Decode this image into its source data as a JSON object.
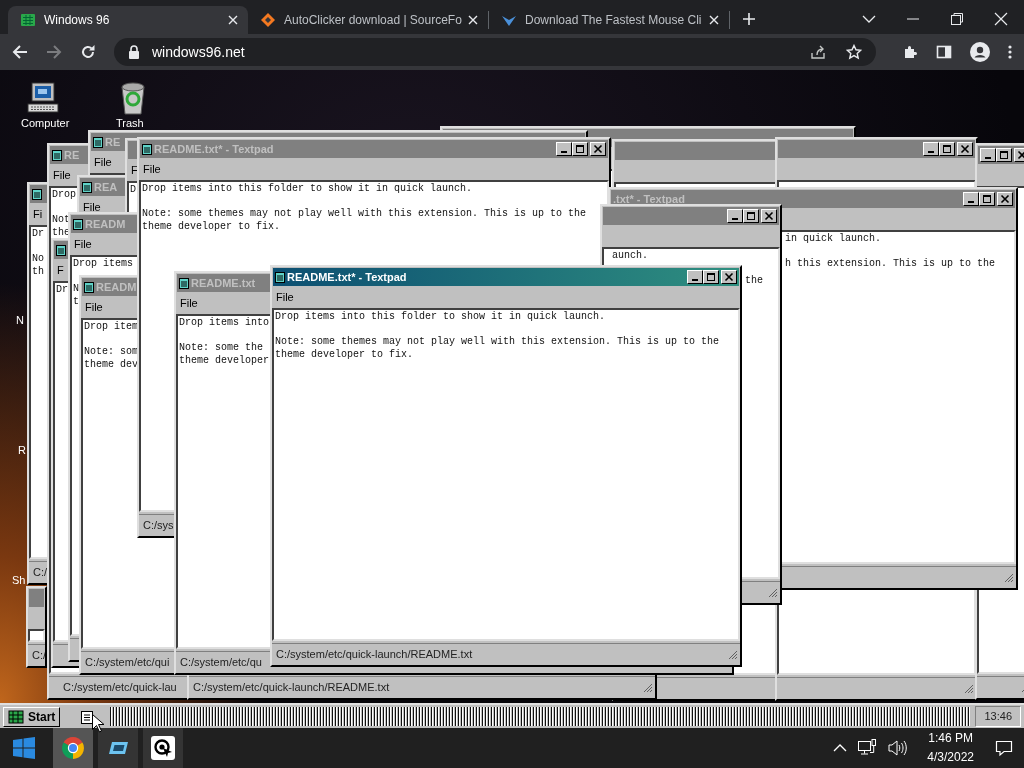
{
  "browser": {
    "tabs": [
      {
        "title": "Windows 96",
        "selected": true
      },
      {
        "title": "AutoClicker download | SourceFo",
        "selected": false
      },
      {
        "title": "Download The Fastest Mouse Cli",
        "selected": false
      }
    ],
    "address": "windows96.net"
  },
  "desktop": {
    "icons": [
      {
        "label": "Computer",
        "kind": "computer"
      },
      {
        "label": "Trash",
        "kind": "trash"
      }
    ],
    "cut_labels": [
      "N",
      "R",
      "Sh"
    ]
  },
  "windows": [
    {
      "active": false
    },
    {
      "active": false
    },
    {
      "active": false
    },
    {
      "active": false
    },
    {
      "active": false,
      "menu": "Fi",
      "paragraphs": [
        [
          "Dr"
        ],
        [
          "No",
          "th"
        ]
      ],
      "status": "C:/"
    },
    {
      "active": false,
      "status": "C:/"
    },
    {
      "active": false,
      "title": "RE",
      "menu": "File",
      "paragraphs": [
        [
          "Drop"
        ],
        [
          "Not",
          "the"
        ]
      ],
      "status": "C:/system/etc/quick-lau"
    },
    {
      "active": false,
      "title": "RE",
      "menu": "File"
    },
    {
      "active": false,
      "title": "REA",
      "menu": "File"
    },
    {
      "active": false,
      "menu": "F",
      "paragraphs": [
        [
          "D"
        ]
      ]
    },
    {
      "active": false,
      "menu": "F",
      "paragraphs": [
        [
          "Dr"
        ]
      ]
    },
    {
      "active": false,
      "title": "READM",
      "menu": "File",
      "paragraphs": [
        [
          "Drop items"
        ],
        [
          "N",
          "t"
        ]
      ]
    },
    {
      "status": "C:/system/etc/quick-launch/README.txt"
    },
    {
      "active": false,
      "title": "README.txt* - Textpad",
      "menu": "File",
      "paragraphs": [
        [
          "Drop items into this folder to show it in quick launch."
        ],
        [
          "Note: some themes may not play well with this extension. This is up to the",
          "theme developer to fix."
        ]
      ],
      "status": "C:/sys"
    },
    {
      "active": false,
      "title": "READM",
      "menu": "File",
      "paragraphs": [
        [
          "Drop item"
        ],
        [
          "Note: som",
          "theme dev"
        ]
      ],
      "status": "C:/system/etc/qui"
    },
    {
      "active": false,
      "title": ".txt* - Textpad",
      "paragraphs": [
        [
          "in quick launch."
        ],
        [
          "h this extension. This is up to the"
        ]
      ]
    },
    {
      "active": false,
      "paragraphs": [
        [
          "aunch."
        ],
        [
          "the"
        ]
      ]
    },
    {
      "active": false,
      "title": "README.txt",
      "menu": "File",
      "paragraphs": [
        [
          "Drop items into"
        ],
        [
          "Note: some the",
          "theme developer"
        ]
      ],
      "status": "C:/system/etc/qu"
    },
    {
      "active": true,
      "title": "README.txt* - Textpad",
      "menu": "File",
      "paragraphs": [
        [
          "Drop items into this folder to show it in quick launch."
        ],
        [
          "Note: some themes may not play well with this extension. This is up to the",
          "theme developer to fix."
        ]
      ],
      "status": "C:/system/etc/quick-launch/README.txt"
    }
  ],
  "taskbar96": {
    "start": "Start",
    "clock": "13:46"
  },
  "taskbar": {
    "apps": [
      {
        "kind": "browser",
        "selected": true
      },
      {
        "kind": "app",
        "selected": false
      },
      {
        "kind": "clicker",
        "selected": false
      }
    ],
    "time": "1:46 PM",
    "date": "4/3/2022"
  }
}
